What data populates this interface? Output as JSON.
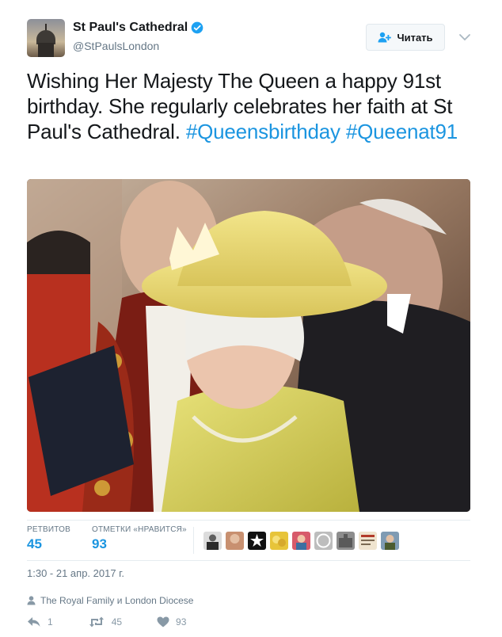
{
  "author": {
    "name": "St Paul's Cathedral",
    "handle": "@StPaulsLondon",
    "verified": true
  },
  "follow_button": {
    "label": "Читать",
    "icon": "add-user-icon"
  },
  "tweet": {
    "text_plain": "Wishing Her Majesty The Queen a happy 91st birthday. She regularly celebrates her faith at St Paul's Cathedral.",
    "hashtags": [
      "#Queensbirthday",
      "#Queenat91"
    ],
    "hashtag_color": "#1b95e0"
  },
  "stats": {
    "retweets_label": "РЕТВИТОВ",
    "retweets_value": "45",
    "likes_label": "ОТМЕТКИ «НРАВИТСЯ»",
    "likes_value": "93"
  },
  "likers_count_shown": 9,
  "timestamp": "1:30 - 21 апр. 2017 г.",
  "context": {
    "icon": "person-icon",
    "text": "The Royal Family и London Diocese"
  },
  "actions": [
    {
      "name": "reply",
      "icon": "reply-icon",
      "count": "1"
    },
    {
      "name": "retweet",
      "icon": "retweet-icon",
      "count": "45"
    },
    {
      "name": "like",
      "icon": "heart-icon",
      "count": "93"
    }
  ]
}
